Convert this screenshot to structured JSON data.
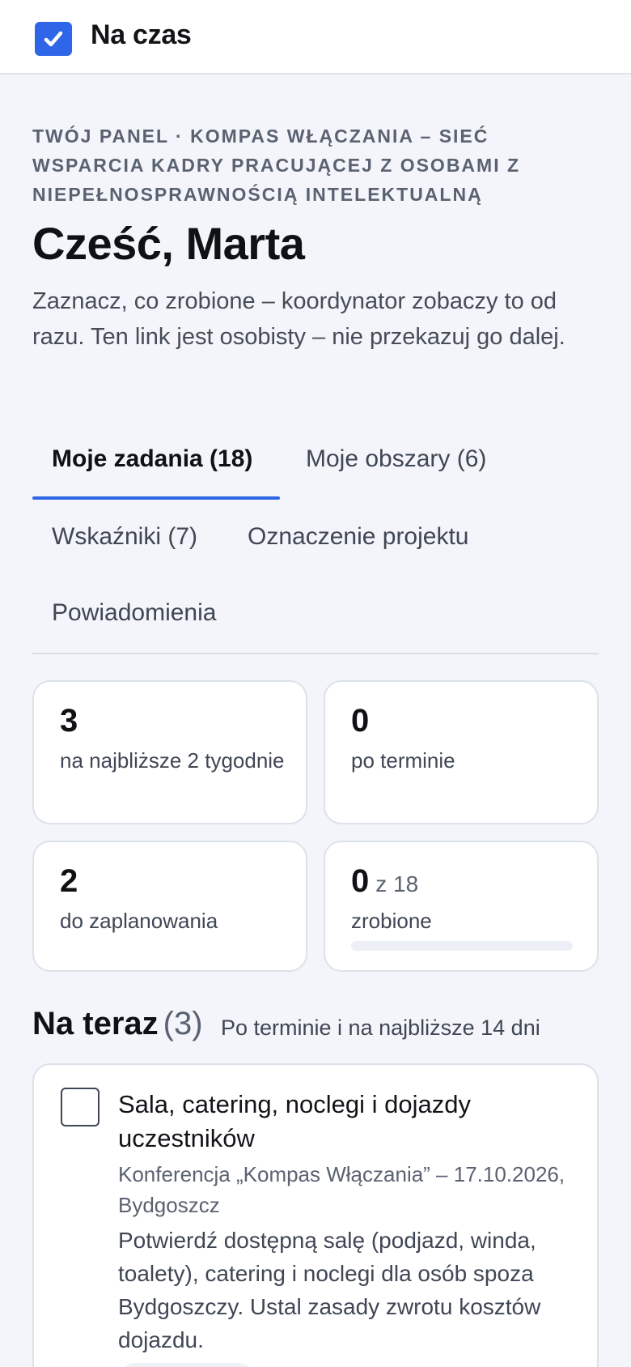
{
  "app": {
    "title": "Na czas",
    "logo_icon": "checkbox-checked-icon",
    "accent": "#2f66e8"
  },
  "header": {
    "eyebrow": "Twój panel · Kompas Włączania – Sieć Wsparcia Kadry Pracującej z Osobami z Niepełnosprawnością Intelektualną",
    "greeting": "Cześć, Marta",
    "intro": "Zaznacz, co zrobione – koordynator zobaczy to od razu. Ten link jest osobisty – nie przekazuj go dalej."
  },
  "tabs": [
    {
      "label": "Moje zadania (18)",
      "active": true
    },
    {
      "label": "Moje obszary (6)",
      "active": false
    },
    {
      "label": "Wskaźniki (7)",
      "active": false
    },
    {
      "label": "Oznaczenie projektu",
      "active": false
    },
    {
      "label": "Powiadomienia",
      "active": false
    }
  ],
  "stats": [
    {
      "value": "3",
      "label": "na najbliższe 2 tygodnie"
    },
    {
      "value": "0",
      "label": "po terminie"
    },
    {
      "value": "2",
      "label": "do zaplanowania"
    },
    {
      "value": "0",
      "of": "z 18",
      "label": "zrobione",
      "progress": 0
    }
  ],
  "section": {
    "title": "Na teraz",
    "count": "(3)",
    "subtitle": "Po terminie i na najbliższe 14 dni"
  },
  "tasks": [
    {
      "title": "Sala, catering, noclegi i dojazdy uczestników",
      "context": "Konferencja „Kompas Włączania” – 17.10.2026, Bydgoszcz",
      "description": "Potwierdź dostępną salę (podjazd, winda, toalety), catering i noclegi dla osób spoza Bydgoszczy. Ustal zasady zwrotu kosztów dojazdu.",
      "done": false
    }
  ]
}
